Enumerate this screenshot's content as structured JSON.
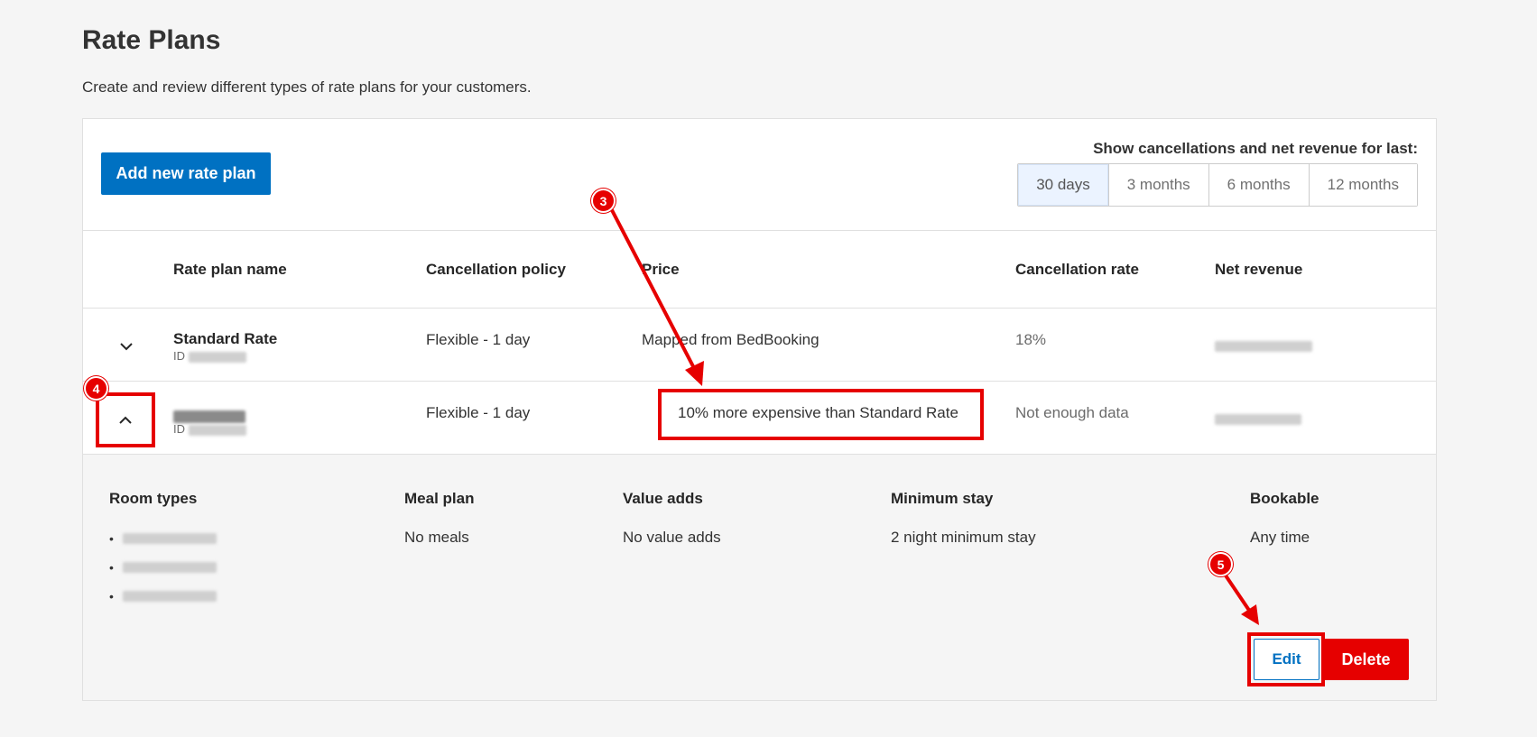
{
  "header": {
    "title": "Rate Plans",
    "subtitle": "Create and review different types of rate plans for your customers."
  },
  "toolbar": {
    "add_label": "Add new rate plan",
    "period_label": "Show cancellations and net revenue for last:",
    "periods": [
      "30 days",
      "3 months",
      "6 months",
      "12 months"
    ],
    "active_period": "30 days"
  },
  "table": {
    "columns": [
      "Rate plan name",
      "Cancellation policy",
      "Price",
      "Cancellation rate",
      "Net revenue"
    ],
    "rows": [
      {
        "name": "Standard Rate",
        "id_label": "ID",
        "cancellation_policy": "Flexible - 1 day",
        "price": "Mapped from BedBooking",
        "cancellation_rate": "18%",
        "expanded": false
      },
      {
        "id_label": "ID",
        "cancellation_policy": "Flexible - 1 day",
        "price": "10% more expensive than Standard Rate",
        "cancellation_rate": "Not enough data",
        "expanded": true
      }
    ]
  },
  "details": {
    "room_types_label": "Room types",
    "meal_plan_label": "Meal plan",
    "meal_plan_value": "No meals",
    "value_adds_label": "Value adds",
    "value_adds_value": "No value adds",
    "minimum_stay_label": "Minimum stay",
    "minimum_stay_value": "2 night minimum stay",
    "bookable_label": "Bookable",
    "bookable_value": "Any time",
    "edit_label": "Edit",
    "delete_label": "Delete"
  },
  "annotations": {
    "step_3": "3",
    "step_4": "4",
    "step_5": "5",
    "highlight_color": "#e60000"
  },
  "colors": {
    "primary": "#0071c2",
    "danger": "#e60000"
  }
}
